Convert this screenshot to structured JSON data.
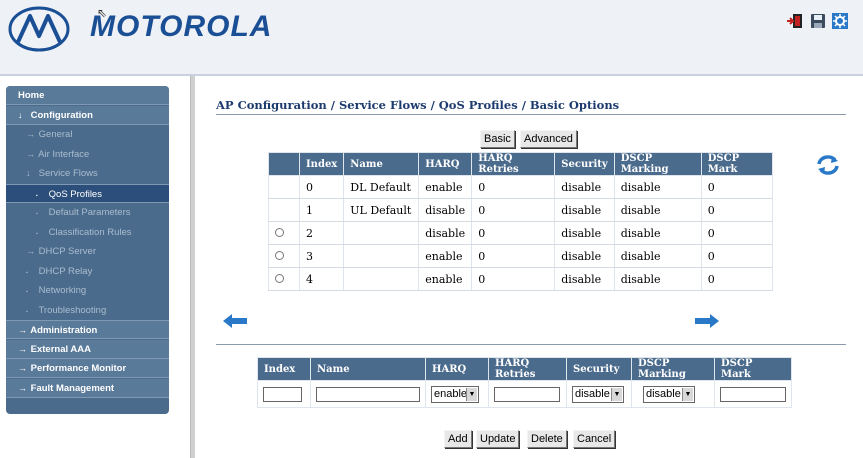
{
  "header": {
    "brand": "MOTOROLA",
    "logo_icon": "motorola-batwing-logo",
    "cursor_glyph": "⇖",
    "icons": [
      "logout-icon",
      "save-icon",
      "settings-icon"
    ]
  },
  "sidebar": {
    "items": [
      {
        "label": "Home",
        "level": "top",
        "arrow": ""
      },
      {
        "label": "Configuration",
        "level": "top",
        "arrow": "↓"
      },
      {
        "label": "General",
        "level": "sub",
        "arrow": "→"
      },
      {
        "label": "Air Interface",
        "level": "sub",
        "arrow": "→"
      },
      {
        "label": "Service Flows",
        "level": "sub",
        "arrow": "↓"
      },
      {
        "label": "QoS Profiles",
        "level": "subsub",
        "arrow": "▪",
        "active": true
      },
      {
        "label": "Default Parameters",
        "level": "subsub",
        "arrow": "▪"
      },
      {
        "label": "Classification Rules",
        "level": "subsub",
        "arrow": "▪"
      },
      {
        "label": "DHCP Server",
        "level": "sub",
        "arrow": "→"
      },
      {
        "label": "DHCP Relay",
        "level": "sub",
        "arrow": "▪"
      },
      {
        "label": "Networking",
        "level": "sub",
        "arrow": "▪"
      },
      {
        "label": "Troubleshooting",
        "level": "sub",
        "arrow": "▪"
      },
      {
        "label": "Administration",
        "level": "top",
        "arrow": "→"
      },
      {
        "label": "External AAA",
        "level": "top",
        "arrow": "→"
      },
      {
        "label": "Performance Monitor",
        "level": "top",
        "arrow": "→"
      },
      {
        "label": "Fault Management",
        "level": "top",
        "arrow": "→"
      }
    ]
  },
  "main": {
    "title": "AP Configuration / Service Flows / QoS Profiles / Basic Options",
    "tabs": [
      {
        "label": "Basic"
      },
      {
        "label": "Advanced"
      }
    ],
    "table": {
      "columns": [
        "",
        "Index",
        "Name",
        "HARQ",
        "HARQ Retries",
        "Security",
        "DSCP Marking",
        "DSCP Mark"
      ],
      "rows": [
        {
          "selectable": false,
          "cells": [
            "0",
            "DL Default",
            "enable",
            "0",
            "disable",
            "disable",
            "0"
          ]
        },
        {
          "selectable": false,
          "cells": [
            "1",
            "UL Default",
            "disable",
            "0",
            "disable",
            "disable",
            "0"
          ]
        },
        {
          "selectable": true,
          "cells": [
            "2",
            "",
            "disable",
            "0",
            "disable",
            "disable",
            "0"
          ]
        },
        {
          "selectable": true,
          "cells": [
            "3",
            "",
            "enable",
            "0",
            "disable",
            "disable",
            "0"
          ]
        },
        {
          "selectable": true,
          "cells": [
            "4",
            "",
            "enable",
            "0",
            "disable",
            "disable",
            "0"
          ]
        }
      ]
    },
    "icons": {
      "refresh": "refresh-icon",
      "prev": "prev-arrow-icon",
      "next": "next-arrow-icon"
    }
  },
  "add_form": {
    "columns": [
      "Index",
      "Name",
      "HARQ",
      "HARQ Retries",
      "Security",
      "DSCP Marking",
      "DSCP Mark"
    ],
    "index_value": "",
    "name_value": "",
    "harq_value": "enable",
    "harq_retries_value": "",
    "security_value": "disable",
    "dscp_marking_value": "disable",
    "dscp_mark_value": "",
    "buttons": {
      "add": "Add",
      "update": "Update",
      "delete": "Delete",
      "cancel": "Cancel"
    }
  },
  "colors": {
    "brand": "#1a4f95",
    "nav_bg": "#4b6b8c",
    "table_header": "#4b6b8c",
    "title": "#1d3b6e"
  }
}
